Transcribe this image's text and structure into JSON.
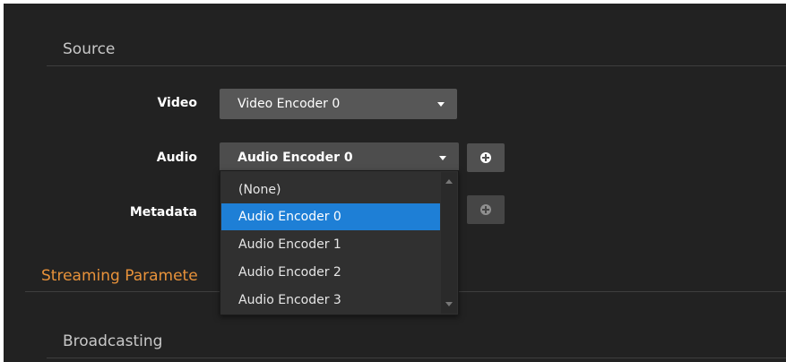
{
  "source": {
    "title": "Source",
    "video": {
      "label": "Video",
      "value": "Video Encoder 0"
    },
    "audio": {
      "label": "Audio",
      "value": "Audio Encoder 0"
    },
    "metadata": {
      "label": "Metadata"
    }
  },
  "dropdown": {
    "options": [
      "(None)",
      "Audio Encoder 0",
      "Audio Encoder 1",
      "Audio Encoder 2",
      "Audio Encoder 3"
    ],
    "selected": "Audio Encoder 0"
  },
  "streaming": {
    "title": "Streaming Paramete"
  },
  "broadcasting": {
    "title": "Broadcasting"
  },
  "colors": {
    "panel_bg": "#222222",
    "accent_orange": "#e8923a",
    "selected_blue": "#1e7fd6",
    "control_gray": "#4d4d4d"
  },
  "icons": [
    "plus-circle-icon",
    "chevron-down-icon"
  ]
}
